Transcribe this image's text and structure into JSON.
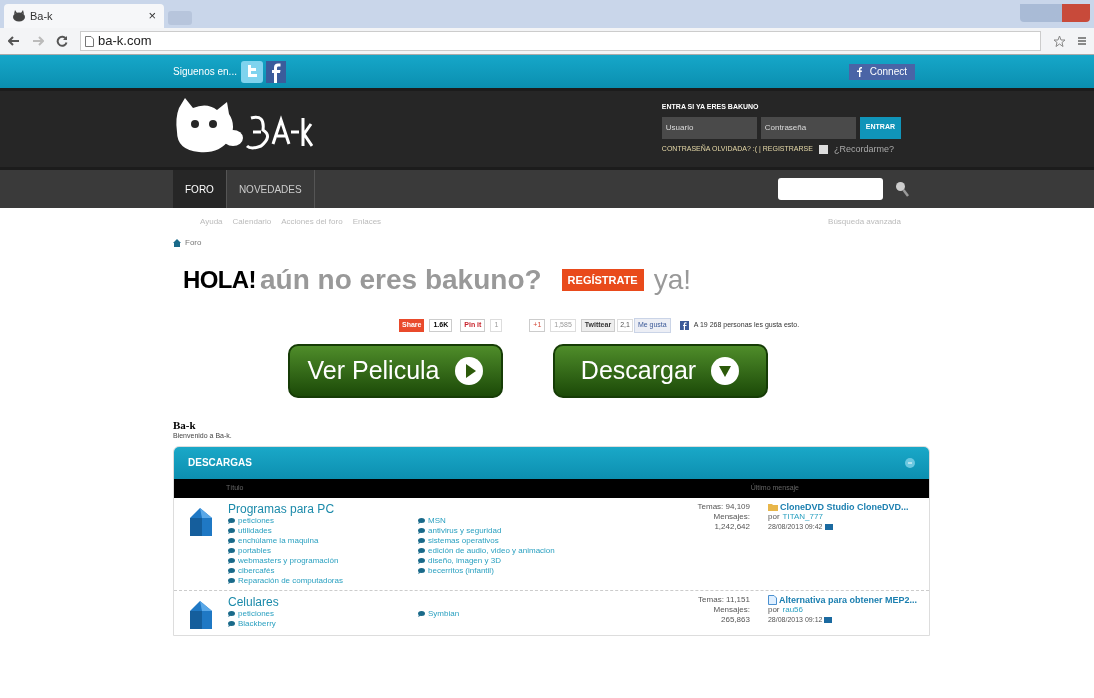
{
  "browser": {
    "tab_title": "Ba-k",
    "tab_close": "×",
    "url": "ba-k.com"
  },
  "topbar": {
    "follow": "Siguenos en...",
    "connect": "Connect"
  },
  "login": {
    "title": "ENTRA SI YA ERES BAKUNO",
    "user_placeholder": "Usuario",
    "pass_placeholder": "Contraseña",
    "submit": "ENTRAR",
    "forgot": "CONTRASEÑA OLVIDADA? :( | REGISTRARSE",
    "remember": "¿Recordarme?",
    "remember_checked": false
  },
  "nav": [
    {
      "label": "FORO",
      "selected": true
    },
    {
      "label": "NOVEDADES",
      "selected": false
    }
  ],
  "sublinks": [
    "Ayuda",
    "Calendario",
    "Acciones del foro",
    "Enlaces"
  ],
  "advanced_search": "Búsqueda avanzada",
  "breadcrumb": "Foro",
  "headline": {
    "hola": "HOLA!",
    "question": "aún no eres bakuno?",
    "register": "REGÍSTRATE",
    "ya": "ya!"
  },
  "share": {
    "share": "Share",
    "share_count": "1.6K",
    "pin": "Pin it",
    "pin_count": "1",
    "gplus": "+1",
    "gplus_count": "1,585",
    "tweet": "Twittear",
    "tweet_count": "2,1",
    "like": "Me gusta",
    "like_text": "A 19 268 personas les gusta esto."
  },
  "big_buttons": [
    {
      "label": "Ver Pelicula",
      "kind": "play"
    },
    {
      "label": "Descargar",
      "kind": "down"
    }
  ],
  "site": {
    "name": "Ba-k",
    "welcome": "Bienvenido a Ba-k."
  },
  "forum": {
    "title": "DESCARGAS",
    "columns": [
      "Título",
      "Último mensaje"
    ],
    "rows": [
      {
        "title": "Programas para PC",
        "subs_left": [
          "peticiones",
          "utilidades",
          "enchúlame la maquina",
          "portables",
          "webmasters y programación",
          "cibercafés",
          "Reparación de computadoras"
        ],
        "subs_right": [
          "MSN",
          "antivirus y seguridad",
          "sistemas operativos",
          "edición de audio, video y animacion",
          "diseño, imagen y 3D",
          "becerritos (infantil)"
        ],
        "temas": "Temas: 94,109",
        "mensajes_label": "Mensajes:",
        "mensajes": "1,242,642",
        "last_title": "CloneDVD Studio CloneDVD...",
        "last_by": "por",
        "last_user": "TITAN_777",
        "last_date": "28/08/2013 09:42",
        "kind": "folder"
      },
      {
        "title": "Celulares",
        "subs_left": [
          "peticiones",
          "Blackberry"
        ],
        "subs_right": [
          "Symbian"
        ],
        "temas": "Temas: 11,151",
        "mensajes_label": "Mensajes:",
        "mensajes": "265,863",
        "last_title": "Alternativa para obtener MEP2...",
        "last_by": "por",
        "last_user": "rau56",
        "last_date": "28/08/2013 09:12",
        "kind": "doc"
      }
    ]
  }
}
